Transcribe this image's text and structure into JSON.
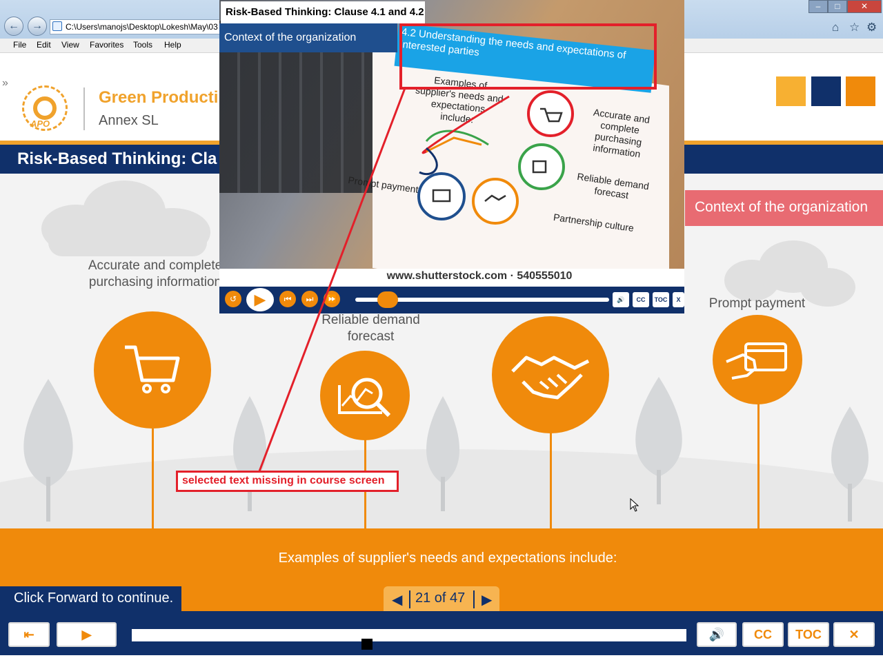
{
  "browser": {
    "address": "C:\\Users\\manojs\\Desktop\\Lokesh\\May\\03",
    "menu": [
      "File",
      "Edit",
      "View",
      "Favorites",
      "Tools",
      "Help"
    ],
    "window_controls": [
      "–",
      "□",
      "✕"
    ]
  },
  "course": {
    "brand_name": "Green Producti",
    "brand_sub": "Annex SL",
    "logo_text": "APO",
    "title": "Risk-Based Thinking: Cla",
    "context_tab": "Context of the organization",
    "labels": {
      "accurate": "Accurate and complete purchasing information",
      "reliable": "Reliable demand forecast",
      "prompt": "Prompt payment"
    },
    "band_text": "Examples of supplier's needs and expectations include:",
    "forward_text": "Click Forward to continue.",
    "pager": "21 of 47",
    "player_buttons": [
      "exit",
      "play",
      "volume",
      "CC",
      "TOC",
      "close"
    ],
    "player_labels": {
      "cc": "CC",
      "toc": "TOC"
    }
  },
  "overlay": {
    "title": "Risk-Based Thinking:  Clause 4.1 and 4.2",
    "context": "Context of the organization",
    "heading": "4.2 Understanding the needs  and expectations of interested parties",
    "examples": "Examples of supplier's needs and expectations include:",
    "items": {
      "accurate": "Accurate and complete purchasing information",
      "reliable": "Reliable demand forecast",
      "prompt": "Prompt payment",
      "partnership": "Partnership culture"
    },
    "watermark": "www.shutterstock.com · 540555010",
    "player_labels": {
      "cc": "CC",
      "toc": "TOC",
      "close": "X"
    }
  },
  "annotation": {
    "note": "selected text missing in course screen"
  },
  "colors": {
    "navy": "#10306a",
    "orange": "#f08a0b",
    "light_orange": "#f7b451",
    "red_annotation": "#e3202a",
    "context_pink": "#e86b72",
    "overlay_blue": "#1aa3e6"
  }
}
